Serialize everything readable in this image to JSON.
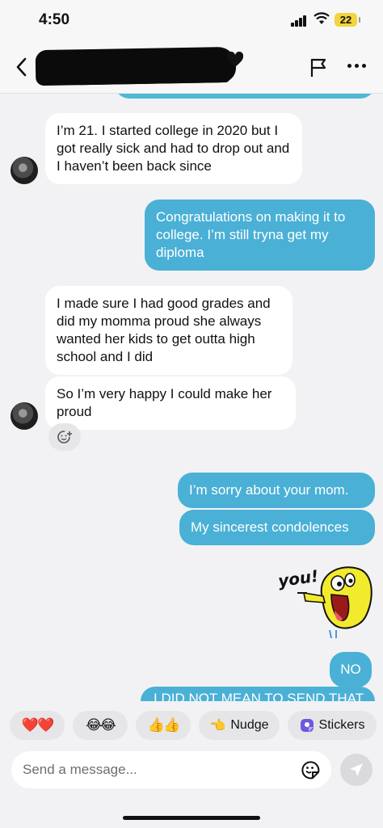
{
  "status": {
    "time": "4:50",
    "battery": "22"
  },
  "chat": {
    "messages": [
      {
        "from": "them",
        "text": "I’m 21. I started college in 2020 but I got really sick and had to drop out and I haven’t been back since"
      },
      {
        "from": "me",
        "text": "Congratulations on making it to college. I’m still tryna get my diploma"
      },
      {
        "from": "them",
        "text": "I made sure I had good grades and did my momma proud she always wanted her kids to get outta high school and I did"
      },
      {
        "from": "them",
        "text": "So I’m very happy I could make her proud"
      },
      {
        "from": "me",
        "text": "I’m sorry about your mom."
      },
      {
        "from": "me",
        "text": "My sincerest condolences"
      },
      {
        "from": "me",
        "type": "sticker",
        "text": "you!"
      },
      {
        "from": "me",
        "text": "NO"
      },
      {
        "from": "me",
        "text": "I DID NOT MEAN TO SEND THAT"
      }
    ]
  },
  "reactions": {
    "chips": [
      {
        "label": "❤️❤️",
        "icon": "hearts"
      },
      {
        "label": "😂😂",
        "icon": "laughing-faces"
      },
      {
        "label": "👍👍",
        "icon": "thumbs-up"
      },
      {
        "label": "Nudge",
        "icon": "pointing-hand"
      },
      {
        "label": "Stickers",
        "icon": "sticker"
      }
    ]
  },
  "composer": {
    "placeholder": "Send a message..."
  },
  "colors": {
    "outgoing": "#4ab0d6",
    "incoming": "#ffffff",
    "background": "#f2f2f4"
  }
}
